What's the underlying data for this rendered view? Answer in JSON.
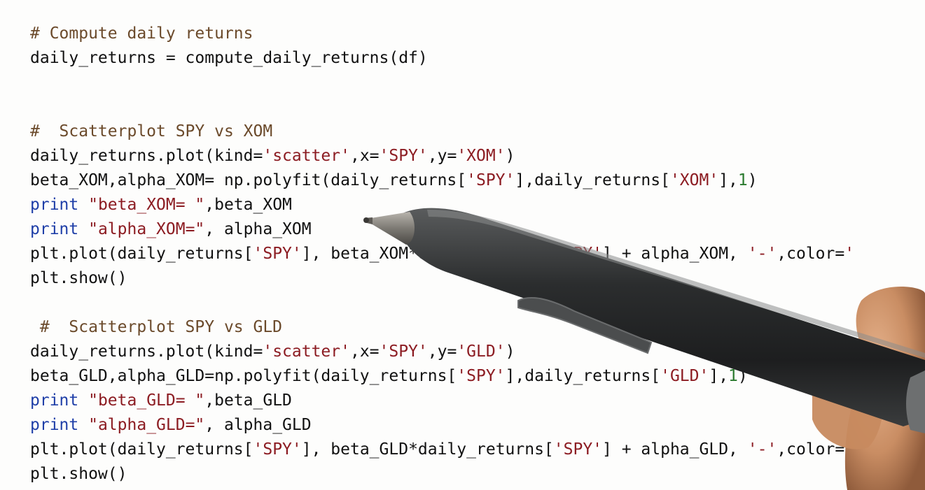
{
  "code_lines": [
    [
      {
        "t": "comment",
        "v": "# Compute daily returns"
      }
    ],
    [
      {
        "t": "plain",
        "v": "daily_returns = compute_daily_returns(df)"
      }
    ],
    [],
    [],
    [
      {
        "t": "comment",
        "v": "#  Scatterplot SPY vs XOM"
      }
    ],
    [
      {
        "t": "plain",
        "v": "daily_returns.plot(kind="
      },
      {
        "t": "string",
        "v": "'scatter'"
      },
      {
        "t": "plain",
        "v": ",x="
      },
      {
        "t": "string",
        "v": "'SPY'"
      },
      {
        "t": "plain",
        "v": ",y="
      },
      {
        "t": "string",
        "v": "'XOM'"
      },
      {
        "t": "plain",
        "v": ")"
      }
    ],
    [
      {
        "t": "plain",
        "v": "beta_XOM,alpha_XOM= np.polyfit(daily_returns["
      },
      {
        "t": "string",
        "v": "'SPY'"
      },
      {
        "t": "plain",
        "v": "],daily_returns["
      },
      {
        "t": "string",
        "v": "'XOM'"
      },
      {
        "t": "plain",
        "v": "],"
      },
      {
        "t": "number",
        "v": "1"
      },
      {
        "t": "plain",
        "v": ")"
      }
    ],
    [
      {
        "t": "keyword",
        "v": "print"
      },
      {
        "t": "plain",
        "v": " "
      },
      {
        "t": "string",
        "v": "\"beta_XOM= \""
      },
      {
        "t": "plain",
        "v": ",beta_XOM"
      }
    ],
    [
      {
        "t": "keyword",
        "v": "print"
      },
      {
        "t": "plain",
        "v": " "
      },
      {
        "t": "string",
        "v": "\"alpha_XOM=\""
      },
      {
        "t": "plain",
        "v": ", alpha_XOM"
      }
    ],
    [
      {
        "t": "plain",
        "v": "plt.plot(daily_returns["
      },
      {
        "t": "string",
        "v": "'SPY'"
      },
      {
        "t": "plain",
        "v": "], beta_XOM*daily_returns["
      },
      {
        "t": "string",
        "v": "'SPY'"
      },
      {
        "t": "plain",
        "v": "] + alpha_XOM, "
      },
      {
        "t": "string",
        "v": "'-'"
      },
      {
        "t": "plain",
        "v": ",color="
      },
      {
        "t": "string",
        "v": "'"
      }
    ],
    [
      {
        "t": "plain",
        "v": "plt.show()"
      }
    ],
    [],
    [
      {
        "t": "comment",
        "v": " #  Scatterplot SPY vs GLD"
      }
    ],
    [
      {
        "t": "plain",
        "v": "daily_returns.plot(kind="
      },
      {
        "t": "string",
        "v": "'scatter'"
      },
      {
        "t": "plain",
        "v": ",x="
      },
      {
        "t": "string",
        "v": "'SPY'"
      },
      {
        "t": "plain",
        "v": ",y="
      },
      {
        "t": "string",
        "v": "'GLD'"
      },
      {
        "t": "plain",
        "v": ")"
      }
    ],
    [
      {
        "t": "plain",
        "v": "beta_GLD,alpha_GLD=np.polyfit(daily_returns["
      },
      {
        "t": "string",
        "v": "'SPY'"
      },
      {
        "t": "plain",
        "v": "],daily_returns["
      },
      {
        "t": "string",
        "v": "'GLD'"
      },
      {
        "t": "plain",
        "v": "],"
      },
      {
        "t": "number",
        "v": "1"
      },
      {
        "t": "plain",
        "v": ")"
      }
    ],
    [
      {
        "t": "keyword",
        "v": "print"
      },
      {
        "t": "plain",
        "v": " "
      },
      {
        "t": "string",
        "v": "\"beta_GLD= \""
      },
      {
        "t": "plain",
        "v": ",beta_GLD"
      }
    ],
    [
      {
        "t": "keyword",
        "v": "print"
      },
      {
        "t": "plain",
        "v": " "
      },
      {
        "t": "string",
        "v": "\"alpha_GLD=\""
      },
      {
        "t": "plain",
        "v": ", alpha_GLD"
      }
    ],
    [
      {
        "t": "plain",
        "v": "plt.plot(daily_returns["
      },
      {
        "t": "string",
        "v": "'SPY'"
      },
      {
        "t": "plain",
        "v": "], beta_GLD*daily_returns["
      },
      {
        "t": "string",
        "v": "'SPY'"
      },
      {
        "t": "plain",
        "v": "] + alpha_GLD, "
      },
      {
        "t": "string",
        "v": "'-'"
      },
      {
        "t": "plain",
        "v": ",color="
      },
      {
        "t": "string",
        "v": "'"
      }
    ],
    [
      {
        "t": "plain",
        "v": "plt.show()"
      }
    ]
  ],
  "colors": {
    "comment": "#6b4a2b",
    "string": "#8c1c22",
    "keyword": "#1f3fa8",
    "number": "#2a7a2e",
    "plain": "#111111",
    "pen_body": "#2b2d2e",
    "skin": "#d9a07a"
  },
  "overlay": {
    "icon": "stylus-pen-in-hand-icon"
  }
}
